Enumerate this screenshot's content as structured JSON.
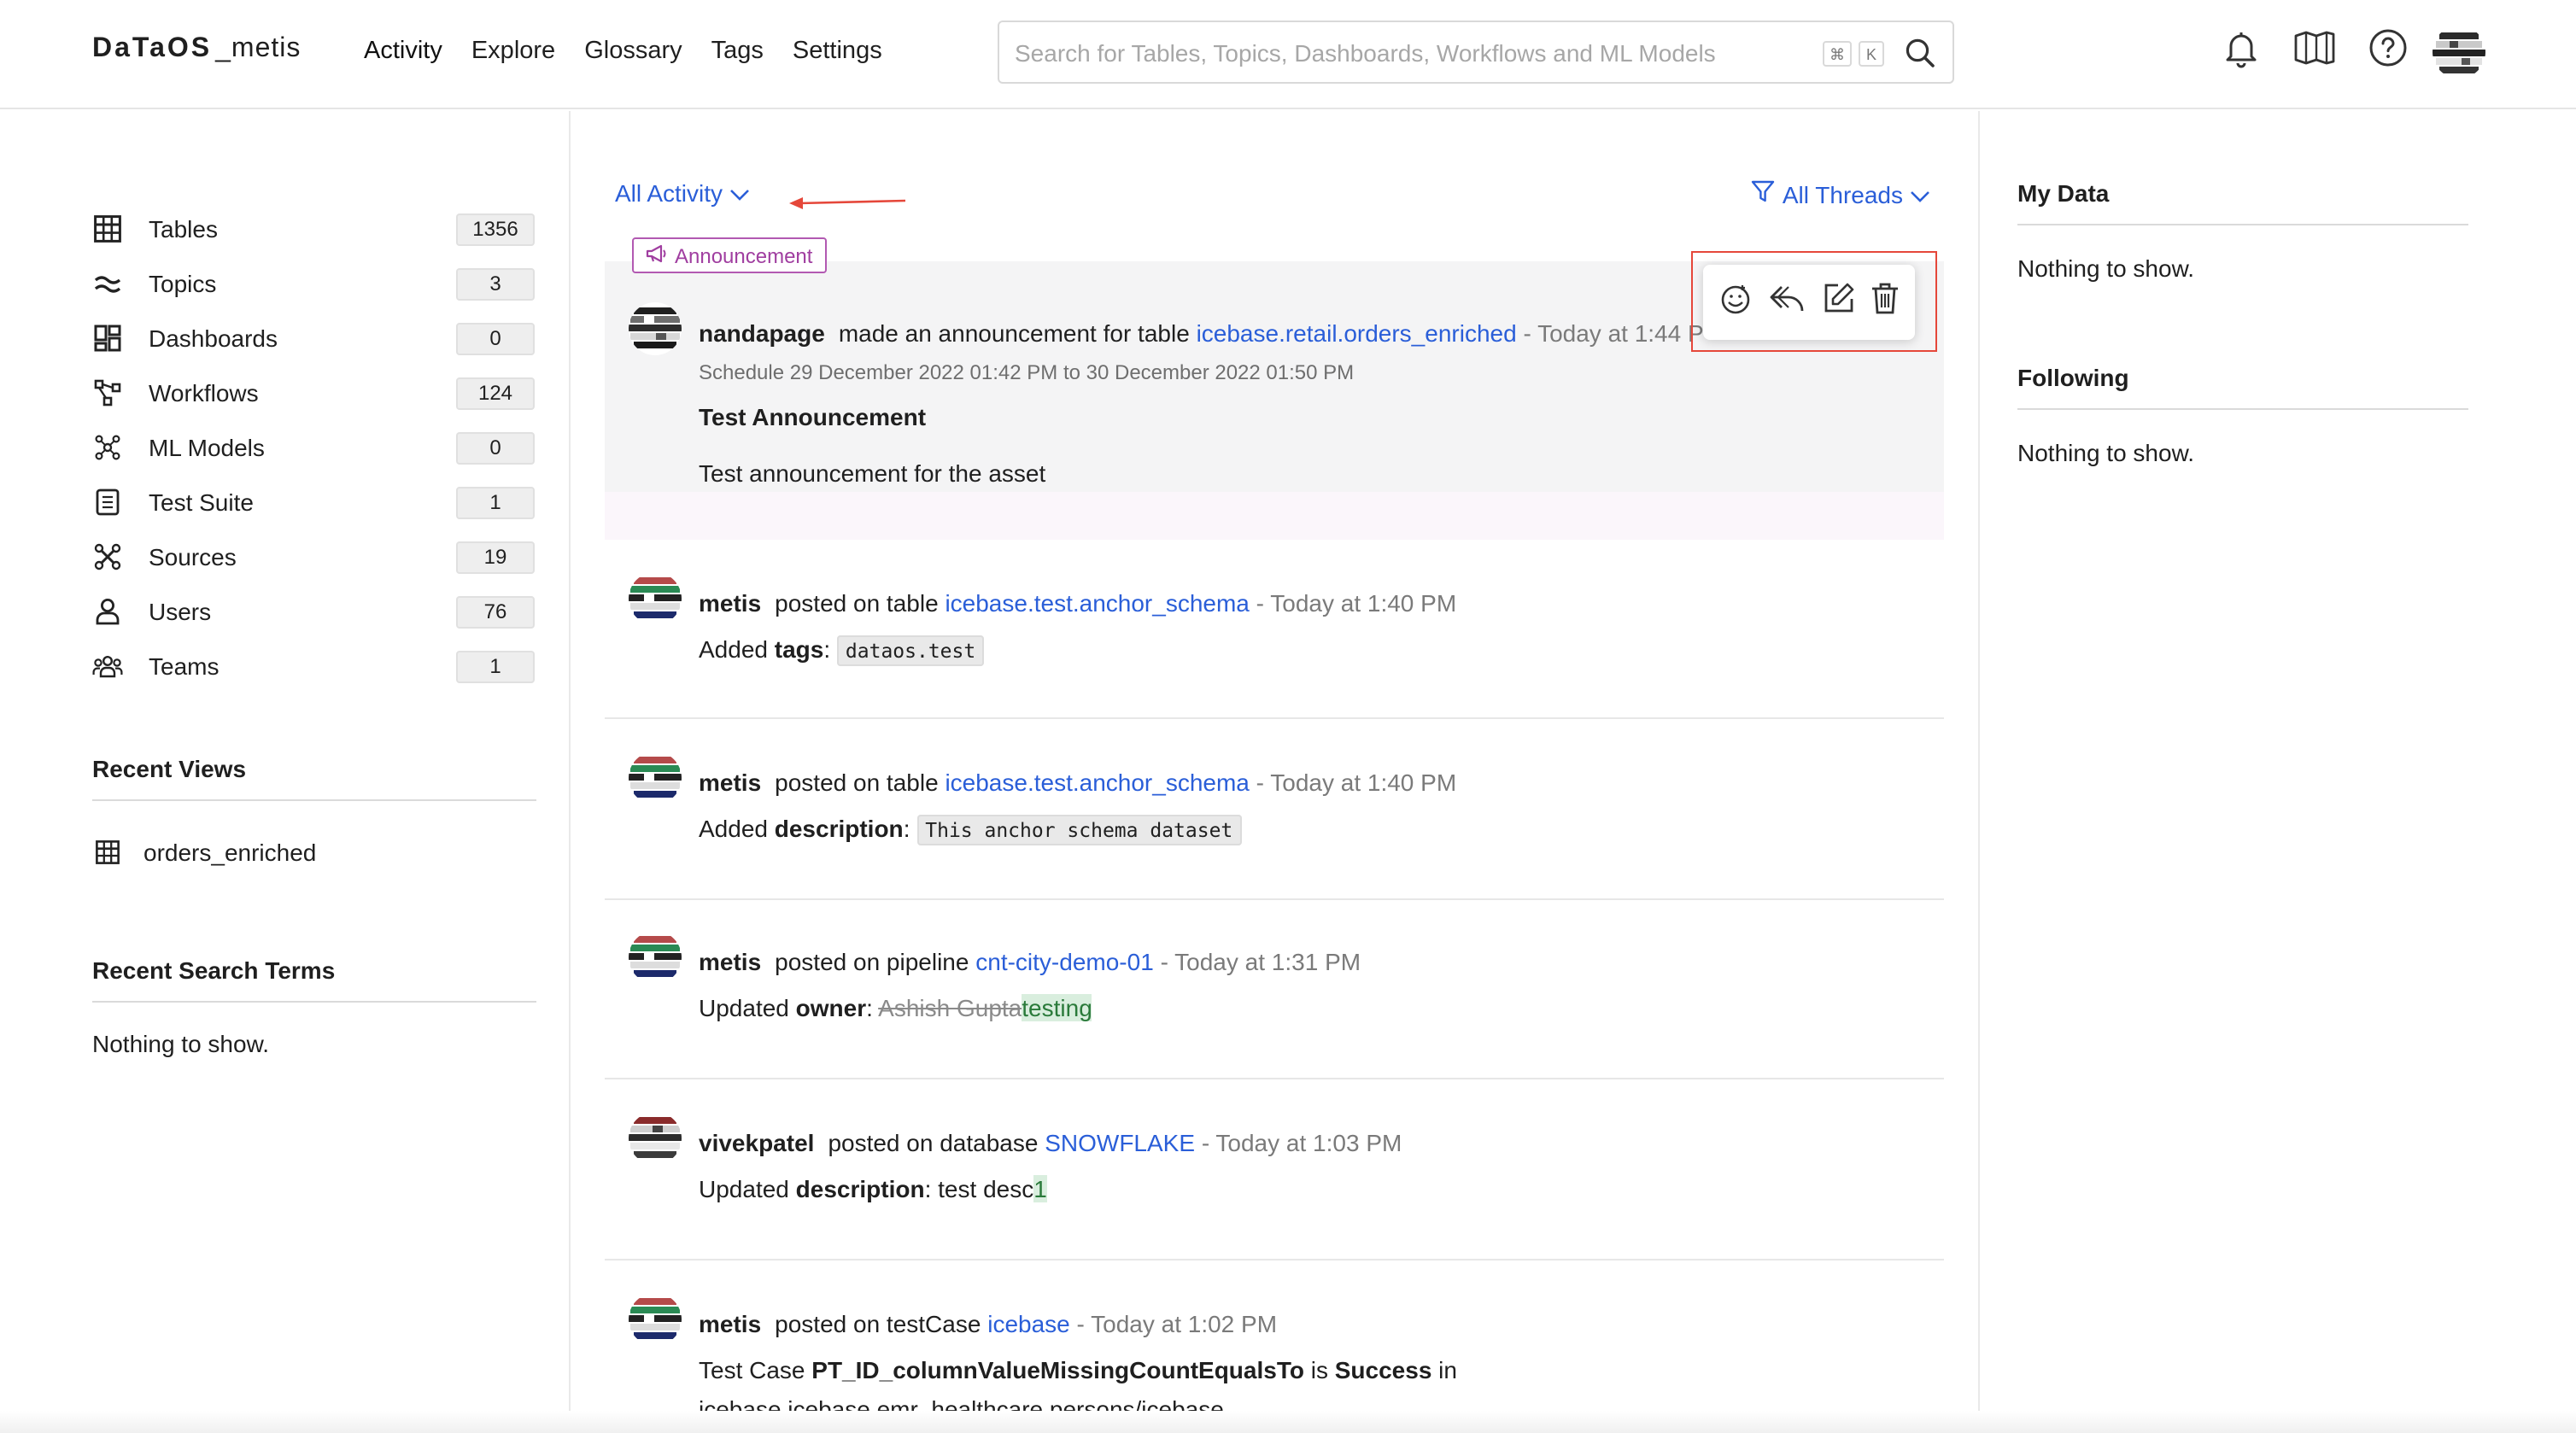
{
  "header": {
    "logo_brand": "DaTaOS",
    "logo_suffix": "_metis",
    "nav": [
      "Activity",
      "Explore",
      "Glossary",
      "Tags",
      "Settings"
    ],
    "active_nav": "Activity",
    "search_placeholder": "Search for Tables, Topics, Dashboards, Workflows and ML Models",
    "search_shortcut_cmd": "⌘",
    "search_shortcut_key": "K",
    "icons": [
      "bell-icon",
      "map-icon",
      "help-icon",
      "user-avatar"
    ]
  },
  "sidebar": {
    "entities": [
      {
        "label": "Tables",
        "count": "1356",
        "icon": "table-icon"
      },
      {
        "label": "Topics",
        "count": "3",
        "icon": "topic-icon"
      },
      {
        "label": "Dashboards",
        "count": "0",
        "icon": "dashboard-icon"
      },
      {
        "label": "Workflows",
        "count": "124",
        "icon": "workflow-icon"
      },
      {
        "label": "ML Models",
        "count": "0",
        "icon": "mlmodel-icon"
      },
      {
        "label": "Test Suite",
        "count": "1",
        "icon": "testsuite-icon"
      },
      {
        "label": "Sources",
        "count": "19",
        "icon": "sources-icon"
      },
      {
        "label": "Users",
        "count": "76",
        "icon": "user-icon"
      },
      {
        "label": "Teams",
        "count": "1",
        "icon": "teams-icon"
      }
    ],
    "recent_views_title": "Recent Views",
    "recent_views": [
      "orders_enriched"
    ],
    "recent_search_title": "Recent Search Terms",
    "recent_search_empty": "Nothing to show."
  },
  "feed": {
    "filter_left": "All Activity",
    "filter_right": "All Threads",
    "announcement": {
      "tag": "Announcement",
      "user": "nandapage",
      "action": "made an announcement for table",
      "entity": "icebase.retail.orders_enriched",
      "time": "- Today at 1:44 P",
      "schedule": "Schedule 29 December 2022 01:42 PM to 30 December 2022 01:50 PM",
      "title": "Test Announcement",
      "body": "Test announcement for the asset"
    },
    "posts": [
      {
        "user": "metis",
        "action": "posted on table",
        "entity": "icebase.test.anchor_schema",
        "time": "- Today at 1:40 PM",
        "prefix": "Added ",
        "field": "tags",
        "sep": ":",
        "code": "dataos.test"
      },
      {
        "user": "metis",
        "action": "posted on table",
        "entity": "icebase.test.anchor_schema",
        "time": "- Today at 1:40 PM",
        "prefix": "Added ",
        "field": "description",
        "sep": ":",
        "code": "This anchor schema dataset"
      },
      {
        "user": "metis",
        "action": "posted on pipeline",
        "entity": "cnt-city-demo-01",
        "time": "- Today at 1:31 PM",
        "prefix": "Updated ",
        "field": "owner",
        "sep": ":",
        "old": "Ashish Gupta",
        "new": "testing"
      },
      {
        "user": "vivekpatel",
        "action": "posted on database",
        "entity": "SNOWFLAKE",
        "time": "- Today at 1:03 PM",
        "prefix": "Updated ",
        "field": "description",
        "sep": ":",
        "text": " test desc",
        "new": "1"
      },
      {
        "user": "metis",
        "action": "posted on testCase",
        "entity": "icebase",
        "time": "- Today at 1:02 PM",
        "tc_prefix": "Test Case ",
        "tc_name": "PT_ID_columnValueMissingCountEqualsTo",
        "tc_is": " is ",
        "tc_status": "Success",
        "tc_in": " in",
        "tc_path": "icebase.icebase.emr_healthcare.persons/icebase"
      }
    ]
  },
  "right_panel": {
    "my_data_title": "My Data",
    "my_data_empty": "Nothing to show.",
    "following_title": "Following",
    "following_empty": "Nothing to show."
  },
  "colors": {
    "link": "#2a5ed8",
    "announcement": "#a03ea0",
    "annotation": "#e5473a"
  }
}
